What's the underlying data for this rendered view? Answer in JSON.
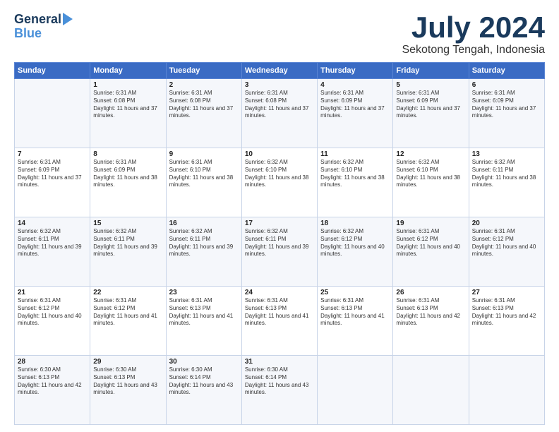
{
  "logo": {
    "line1": "General",
    "line2": "Blue"
  },
  "title": "July 2024",
  "subtitle": "Sekotong Tengah, Indonesia",
  "days_header": [
    "Sunday",
    "Monday",
    "Tuesday",
    "Wednesday",
    "Thursday",
    "Friday",
    "Saturday"
  ],
  "weeks": [
    [
      {
        "day": "",
        "sunrise": "",
        "sunset": "",
        "daylight": ""
      },
      {
        "day": "1",
        "sunrise": "Sunrise: 6:31 AM",
        "sunset": "Sunset: 6:08 PM",
        "daylight": "Daylight: 11 hours and 37 minutes."
      },
      {
        "day": "2",
        "sunrise": "Sunrise: 6:31 AM",
        "sunset": "Sunset: 6:08 PM",
        "daylight": "Daylight: 11 hours and 37 minutes."
      },
      {
        "day": "3",
        "sunrise": "Sunrise: 6:31 AM",
        "sunset": "Sunset: 6:08 PM",
        "daylight": "Daylight: 11 hours and 37 minutes."
      },
      {
        "day": "4",
        "sunrise": "Sunrise: 6:31 AM",
        "sunset": "Sunset: 6:09 PM",
        "daylight": "Daylight: 11 hours and 37 minutes."
      },
      {
        "day": "5",
        "sunrise": "Sunrise: 6:31 AM",
        "sunset": "Sunset: 6:09 PM",
        "daylight": "Daylight: 11 hours and 37 minutes."
      },
      {
        "day": "6",
        "sunrise": "Sunrise: 6:31 AM",
        "sunset": "Sunset: 6:09 PM",
        "daylight": "Daylight: 11 hours and 37 minutes."
      }
    ],
    [
      {
        "day": "7",
        "sunrise": "Sunrise: 6:31 AM",
        "sunset": "Sunset: 6:09 PM",
        "daylight": "Daylight: 11 hours and 37 minutes."
      },
      {
        "day": "8",
        "sunrise": "Sunrise: 6:31 AM",
        "sunset": "Sunset: 6:09 PM",
        "daylight": "Daylight: 11 hours and 38 minutes."
      },
      {
        "day": "9",
        "sunrise": "Sunrise: 6:31 AM",
        "sunset": "Sunset: 6:10 PM",
        "daylight": "Daylight: 11 hours and 38 minutes."
      },
      {
        "day": "10",
        "sunrise": "Sunrise: 6:32 AM",
        "sunset": "Sunset: 6:10 PM",
        "daylight": "Daylight: 11 hours and 38 minutes."
      },
      {
        "day": "11",
        "sunrise": "Sunrise: 6:32 AM",
        "sunset": "Sunset: 6:10 PM",
        "daylight": "Daylight: 11 hours and 38 minutes."
      },
      {
        "day": "12",
        "sunrise": "Sunrise: 6:32 AM",
        "sunset": "Sunset: 6:10 PM",
        "daylight": "Daylight: 11 hours and 38 minutes."
      },
      {
        "day": "13",
        "sunrise": "Sunrise: 6:32 AM",
        "sunset": "Sunset: 6:11 PM",
        "daylight": "Daylight: 11 hours and 38 minutes."
      }
    ],
    [
      {
        "day": "14",
        "sunrise": "Sunrise: 6:32 AM",
        "sunset": "Sunset: 6:11 PM",
        "daylight": "Daylight: 11 hours and 39 minutes."
      },
      {
        "day": "15",
        "sunrise": "Sunrise: 6:32 AM",
        "sunset": "Sunset: 6:11 PM",
        "daylight": "Daylight: 11 hours and 39 minutes."
      },
      {
        "day": "16",
        "sunrise": "Sunrise: 6:32 AM",
        "sunset": "Sunset: 6:11 PM",
        "daylight": "Daylight: 11 hours and 39 minutes."
      },
      {
        "day": "17",
        "sunrise": "Sunrise: 6:32 AM",
        "sunset": "Sunset: 6:11 PM",
        "daylight": "Daylight: 11 hours and 39 minutes."
      },
      {
        "day": "18",
        "sunrise": "Sunrise: 6:32 AM",
        "sunset": "Sunset: 6:12 PM",
        "daylight": "Daylight: 11 hours and 40 minutes."
      },
      {
        "day": "19",
        "sunrise": "Sunrise: 6:31 AM",
        "sunset": "Sunset: 6:12 PM",
        "daylight": "Daylight: 11 hours and 40 minutes."
      },
      {
        "day": "20",
        "sunrise": "Sunrise: 6:31 AM",
        "sunset": "Sunset: 6:12 PM",
        "daylight": "Daylight: 11 hours and 40 minutes."
      }
    ],
    [
      {
        "day": "21",
        "sunrise": "Sunrise: 6:31 AM",
        "sunset": "Sunset: 6:12 PM",
        "daylight": "Daylight: 11 hours and 40 minutes."
      },
      {
        "day": "22",
        "sunrise": "Sunrise: 6:31 AM",
        "sunset": "Sunset: 6:12 PM",
        "daylight": "Daylight: 11 hours and 41 minutes."
      },
      {
        "day": "23",
        "sunrise": "Sunrise: 6:31 AM",
        "sunset": "Sunset: 6:13 PM",
        "daylight": "Daylight: 11 hours and 41 minutes."
      },
      {
        "day": "24",
        "sunrise": "Sunrise: 6:31 AM",
        "sunset": "Sunset: 6:13 PM",
        "daylight": "Daylight: 11 hours and 41 minutes."
      },
      {
        "day": "25",
        "sunrise": "Sunrise: 6:31 AM",
        "sunset": "Sunset: 6:13 PM",
        "daylight": "Daylight: 11 hours and 41 minutes."
      },
      {
        "day": "26",
        "sunrise": "Sunrise: 6:31 AM",
        "sunset": "Sunset: 6:13 PM",
        "daylight": "Daylight: 11 hours and 42 minutes."
      },
      {
        "day": "27",
        "sunrise": "Sunrise: 6:31 AM",
        "sunset": "Sunset: 6:13 PM",
        "daylight": "Daylight: 11 hours and 42 minutes."
      }
    ],
    [
      {
        "day": "28",
        "sunrise": "Sunrise: 6:30 AM",
        "sunset": "Sunset: 6:13 PM",
        "daylight": "Daylight: 11 hours and 42 minutes."
      },
      {
        "day": "29",
        "sunrise": "Sunrise: 6:30 AM",
        "sunset": "Sunset: 6:13 PM",
        "daylight": "Daylight: 11 hours and 43 minutes."
      },
      {
        "day": "30",
        "sunrise": "Sunrise: 6:30 AM",
        "sunset": "Sunset: 6:14 PM",
        "daylight": "Daylight: 11 hours and 43 minutes."
      },
      {
        "day": "31",
        "sunrise": "Sunrise: 6:30 AM",
        "sunset": "Sunset: 6:14 PM",
        "daylight": "Daylight: 11 hours and 43 minutes."
      },
      {
        "day": "",
        "sunrise": "",
        "sunset": "",
        "daylight": ""
      },
      {
        "day": "",
        "sunrise": "",
        "sunset": "",
        "daylight": ""
      },
      {
        "day": "",
        "sunrise": "",
        "sunset": "",
        "daylight": ""
      }
    ]
  ]
}
